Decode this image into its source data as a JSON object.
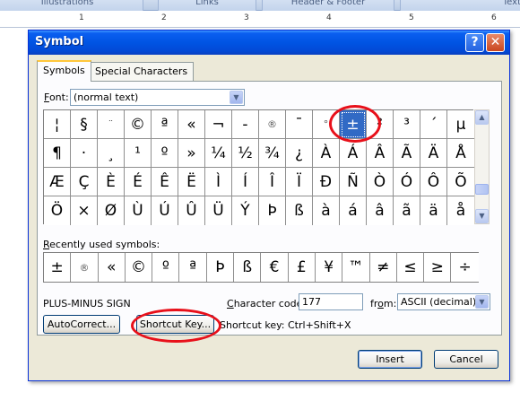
{
  "ribbon": {
    "groups": [
      "Illustrations",
      "Links",
      "Header & Footer",
      "Text"
    ]
  },
  "ruler": {
    "numbers": [
      "1",
      "2",
      "3",
      "4",
      "5",
      "6"
    ]
  },
  "dialog": {
    "title": "Symbol",
    "help_glyph": "?",
    "close_glyph": "✕",
    "tabs": [
      {
        "label": "Symbols",
        "active": true
      },
      {
        "label": "Special Characters",
        "active": false
      }
    ],
    "font_label_prefix": "F",
    "font_label_rest": "ont:",
    "font_value": "(normal text)",
    "symbols": [
      [
        "¦",
        "§",
        "¨",
        "©",
        "ª",
        "«",
        "¬",
        "-",
        "®",
        "¯",
        "°",
        "±",
        "²",
        "³",
        "´",
        "µ"
      ],
      [
        "¶",
        "·",
        "¸",
        "¹",
        "º",
        "»",
        "¼",
        "½",
        "¾",
        "¿",
        "À",
        "Á",
        "Â",
        "Ã",
        "Ä",
        "Å"
      ],
      [
        "Æ",
        "Ç",
        "È",
        "É",
        "Ê",
        "Ë",
        "Ì",
        "Í",
        "Î",
        "Ï",
        "Ð",
        "Ñ",
        "Ò",
        "Ó",
        "Ô",
        "Õ"
      ],
      [
        "Ö",
        "×",
        "Ø",
        "Ù",
        "Ú",
        "Û",
        "Ü",
        "Ý",
        "Þ",
        "ß",
        "à",
        "á",
        "â",
        "ã",
        "ä",
        "å"
      ]
    ],
    "selected_symbol": "±",
    "recently_used_label_prefix": "R",
    "recently_used_label_rest": "ecently used symbols:",
    "recent_symbols": [
      "±",
      "®",
      "«",
      "©",
      "º",
      "ª",
      "Þ",
      "ß",
      "€",
      "£",
      "¥",
      "™",
      "≠",
      "≤",
      "≥",
      "÷"
    ],
    "char_name": "PLUS-MINUS SIGN",
    "char_code_label_prefix": "C",
    "char_code_label_rest": "haracter code:",
    "char_code_value": "177",
    "from_label_prefix": "fr",
    "from_label_u": "o",
    "from_label_rest": "m:",
    "from_value": "ASCII (decimal)",
    "autocorrect_label": "AutoCorrect...",
    "shortcut_key_label": "Shortcut Key...",
    "shortcut_key_text": "Shortcut key: Ctrl+Shift+X",
    "insert_label": "Insert",
    "cancel_label": "Cancel"
  },
  "colors": {
    "titlebar": "#0054e3",
    "selection": "#316ac5",
    "annotation": "#e8101a"
  }
}
